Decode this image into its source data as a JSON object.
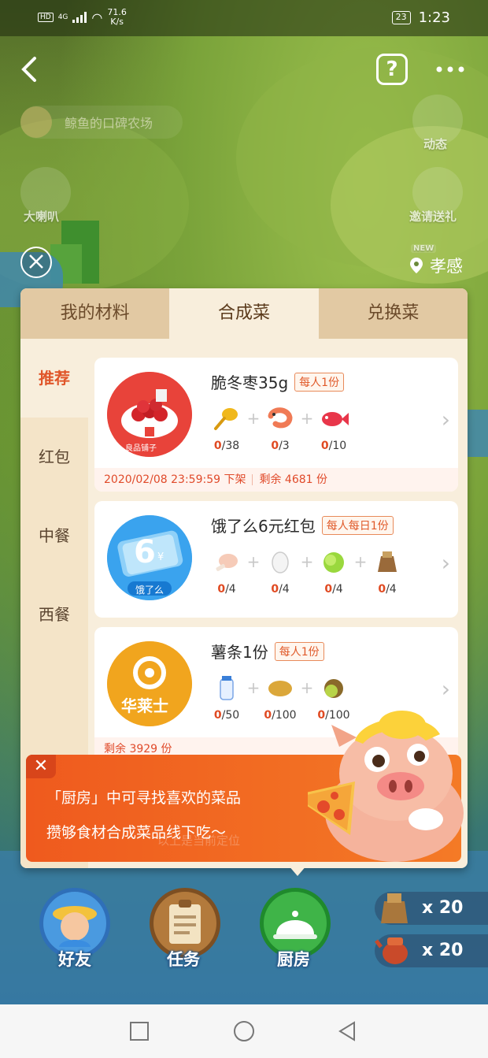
{
  "status_bar": {
    "hd": "HD",
    "network": "4G",
    "speed_value": "71.6",
    "speed_unit": "K/s",
    "battery": "23",
    "time": "1:23"
  },
  "header": {
    "farm_name": "鲸鱼的口碑农场",
    "right_top_label": "动态",
    "left_label": "大喇叭",
    "right_label": "邀请送礼",
    "new_badge": "NEW",
    "location": "孝感"
  },
  "tabs": [
    {
      "label": "我的材料",
      "active": false
    },
    {
      "label": "合成菜",
      "active": true
    },
    {
      "label": "兑换菜",
      "active": false
    }
  ],
  "categories": [
    {
      "label": "推荐",
      "active": true
    },
    {
      "label": "红包",
      "active": false
    },
    {
      "label": "中餐",
      "active": false
    },
    {
      "label": "西餐",
      "active": false
    }
  ],
  "recipes": [
    {
      "title": "脆冬枣35g",
      "limit": "每人1份",
      "brand": "良品铺子",
      "ingredients": [
        {
          "icon": "spoon-icon",
          "have": "0",
          "need": "/38"
        },
        {
          "icon": "shrimp-icon",
          "have": "0",
          "need": "/3"
        },
        {
          "icon": "fish-icon",
          "have": "0",
          "need": "/10"
        }
      ],
      "deadline": "2020/02/08 23:59:59 下架",
      "remaining": "剩余 4681 份"
    },
    {
      "title": "饿了么6元红包",
      "limit": "每人每日1份",
      "brand": "饿了么",
      "coupon_value": "6",
      "coupon_unit": "¥",
      "ingredients": [
        {
          "icon": "chicken-leg-icon",
          "have": "0",
          "need": "/4"
        },
        {
          "icon": "egg-icon",
          "have": "0",
          "need": "/4"
        },
        {
          "icon": "cabbage-icon",
          "have": "0",
          "need": "/4"
        },
        {
          "icon": "sack-icon",
          "have": "0",
          "need": "/4"
        }
      ]
    },
    {
      "title": "薯条1份",
      "limit": "每人1份",
      "brand": "华莱士",
      "ingredients": [
        {
          "icon": "milk-icon",
          "have": "0",
          "need": "/50"
        },
        {
          "icon": "potato-icon",
          "have": "0",
          "need": "/100"
        },
        {
          "icon": "kiwi-icon",
          "have": "0",
          "need": "/100"
        }
      ],
      "remaining": "剩余 3929 份"
    }
  ],
  "promo": {
    "line1": "「厨房」中可寻找喜欢的菜品",
    "line2": "攒够食材合成菜品线下吃～",
    "ghost_text": "以上是当前定位"
  },
  "dock": [
    {
      "label": "好友",
      "icon": "farmer-icon"
    },
    {
      "label": "任务",
      "icon": "clipboard-icon"
    },
    {
      "label": "厨房",
      "icon": "cloche-icon"
    }
  ],
  "resources": [
    {
      "icon": "seed-bag-icon",
      "count": "x 20"
    },
    {
      "icon": "watering-can-icon",
      "count": "x 20"
    }
  ],
  "colors": {
    "accent": "#e0562a",
    "panel": "#f8eedc",
    "tab_bar": "#e2c9a3",
    "promo": "#f06020"
  }
}
